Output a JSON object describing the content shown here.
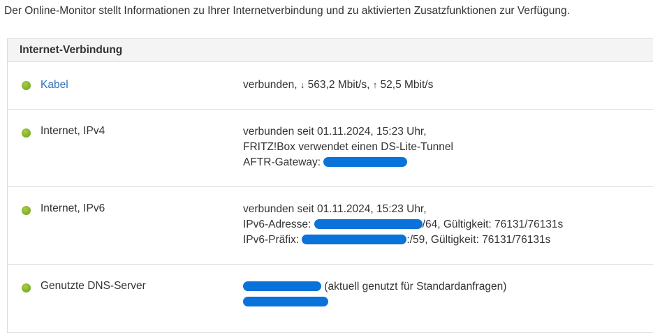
{
  "intro_text": "Der Online-Monitor stellt Informationen zu Ihrer Internetverbindung und zu aktivierten Zusatzfunktionen zur Verfügung.",
  "panel": {
    "title": "Internet-Verbindung",
    "status_color": "#86b42a",
    "link_color": "#2f6fbd",
    "redaction_color": "#0a73d9",
    "rows": {
      "kabel": {
        "name": "Kabel",
        "line1_prefix": "verbunden, ",
        "down_arrow": "↓",
        "down_speed": " 563,2 Mbit/s, ",
        "up_arrow": "↑",
        "up_speed": " 52,5 Mbit/s"
      },
      "ipv4": {
        "name": "Internet, IPv4",
        "line1": "verbunden seit 01.11.2024, 15:23 Uhr,",
        "line2": "FRITZ!Box verwendet einen DS-Lite-Tunnel",
        "line3_label": "AFTR-Gateway: "
      },
      "ipv6": {
        "name": "Internet, IPv6",
        "line1": "verbunden seit 01.11.2024, 15:23 Uhr,",
        "line2_label": "IPv6-Adresse: ",
        "line2_suffix": "/64, Gültigkeit: 76131/76131s",
        "line3_label": "IPv6-Präfix: ",
        "line3_suffix": ":/59, Gültigkeit: 76131/76131s"
      },
      "dns": {
        "name": "Genutzte DNS-Server",
        "line1_suffix": " (aktuell genutzt für Standardanfragen)"
      }
    }
  }
}
